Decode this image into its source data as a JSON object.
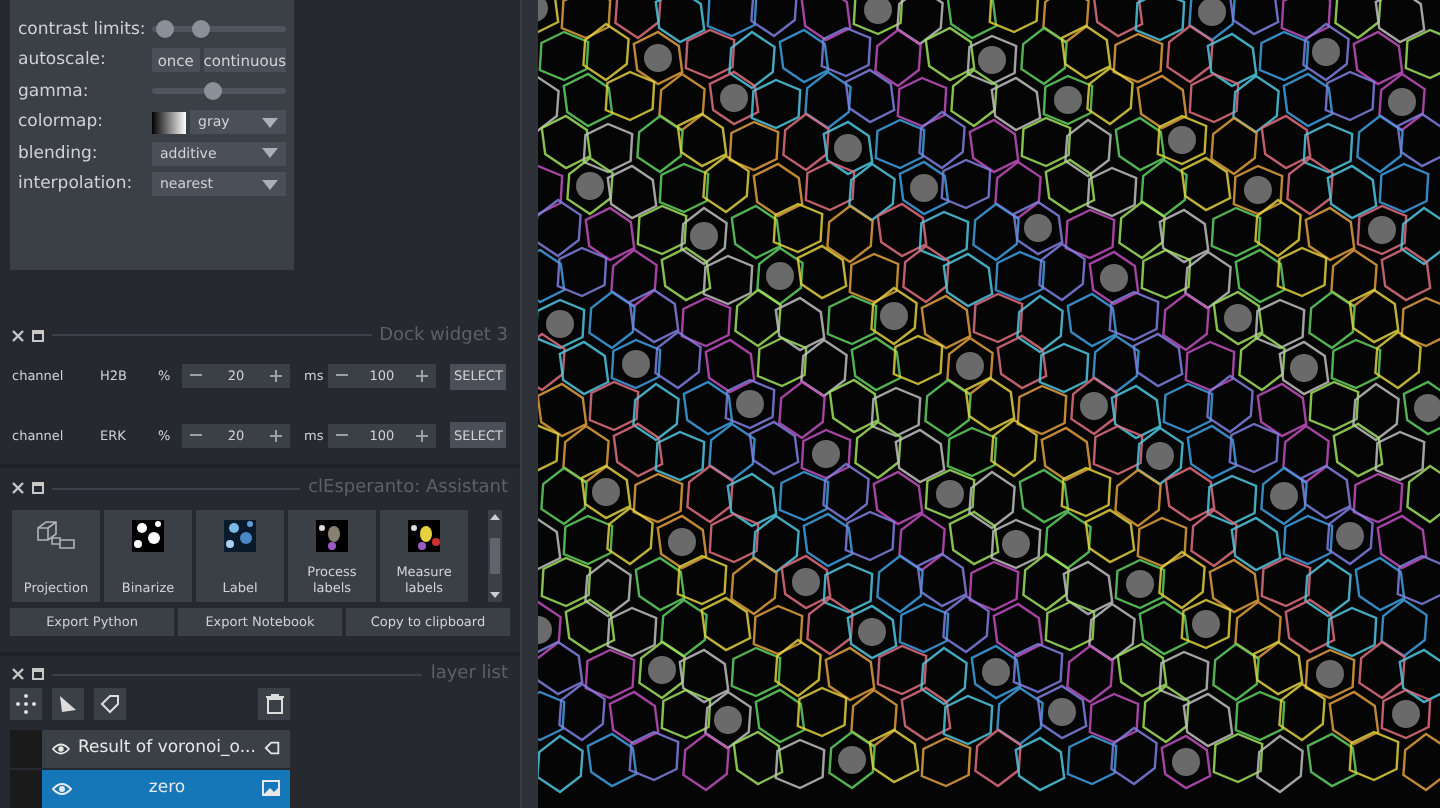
{
  "layer_controls": {
    "rows": [
      {
        "label": "contrast limits:",
        "kind": "range",
        "handles": [
          {
            "level": 0.1
          },
          {
            "level": 0.37
          }
        ]
      },
      {
        "label": "autoscale:",
        "kind": "buttons",
        "buttons": [
          "once",
          "continuous"
        ]
      },
      {
        "label": "gamma:",
        "kind": "slider",
        "level": 0.45
      },
      {
        "label": "colormap:",
        "kind": "colormap",
        "value": "gray"
      },
      {
        "label": "blending:",
        "kind": "dropdown",
        "value": "additive"
      },
      {
        "label": "interpolation:",
        "kind": "dropdown",
        "value": "nearest"
      }
    ]
  },
  "dock_widget": {
    "title": "Dock widget 3",
    "rows": [
      {
        "label": "channel",
        "name": "H2B",
        "percent_unit": "%",
        "percent": "20",
        "ms_unit": "ms",
        "ms": "100",
        "button": "SELECT"
      },
      {
        "label": "channel",
        "name": "ERK",
        "percent_unit": "%",
        "percent": "20",
        "ms_unit": "ms",
        "ms": "100",
        "button": "SELECT"
      }
    ]
  },
  "assistant": {
    "title": "clEsperanto: Assistant",
    "tools": [
      {
        "label": "Projection",
        "kind": "projection"
      },
      {
        "label": "Binarize",
        "kind": "binarize"
      },
      {
        "label": "Label",
        "kind": "label"
      },
      {
        "label": "Process labels",
        "kind": "process"
      },
      {
        "label": "Measure labels",
        "kind": "measure"
      }
    ],
    "exports": [
      "Export Python",
      "Export Notebook",
      "Copy to clipboard"
    ]
  },
  "layer_list": {
    "title": "layer list",
    "layers": [
      {
        "name": "Result of voronoi_o...",
        "kind": "labels",
        "visible": true,
        "selected": false
      },
      {
        "name": "zero",
        "kind": "image",
        "visible": true,
        "selected": true
      }
    ]
  }
}
